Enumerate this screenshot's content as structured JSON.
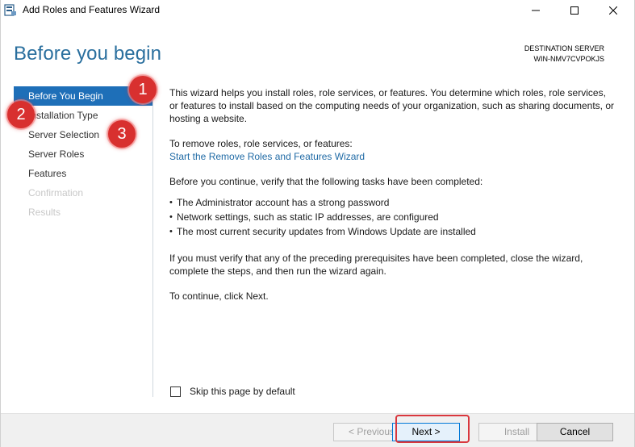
{
  "window": {
    "title": "Add Roles and Features Wizard"
  },
  "header": {
    "page_title": "Before you begin",
    "destination_label": "DESTINATION SERVER",
    "destination_server": "WIN-NMV7CVPOKJS"
  },
  "nav": {
    "items": [
      {
        "label": "Before You Begin",
        "state": "active"
      },
      {
        "label": "Installation Type",
        "state": "normal"
      },
      {
        "label": "Server Selection",
        "state": "normal"
      },
      {
        "label": "Server Roles",
        "state": "normal"
      },
      {
        "label": "Features",
        "state": "normal"
      },
      {
        "label": "Confirmation",
        "state": "disabled"
      },
      {
        "label": "Results",
        "state": "disabled"
      }
    ]
  },
  "content": {
    "intro": "This wizard helps you install roles, role services, or features. You determine which roles, role services, or features to install based on the computing needs of your organization, such as sharing documents, or hosting a website.",
    "remove_text": "To remove roles, role services, or features:",
    "remove_link": "Start the Remove Roles and Features Wizard",
    "verify_text": "Before you continue, verify that the following tasks have been completed:",
    "bullets": [
      "The Administrator account has a strong password",
      "Network settings, such as static IP addresses, are configured",
      "The most current security updates from Windows Update are installed"
    ],
    "prereq_text": "If you must verify that any of the preceding prerequisites have been completed, close the wizard, complete the steps, and then run the wizard again.",
    "continue_text": "To continue, click Next."
  },
  "skip": {
    "label": "Skip this page by default",
    "checked": false
  },
  "footer": {
    "previous_label": "< Previous",
    "next_label": "Next >",
    "install_label": "Install",
    "cancel_label": "Cancel"
  },
  "markers": [
    "1",
    "2",
    "3"
  ],
  "colors": {
    "title_blue": "#2a6f9e",
    "nav_active": "#1e6fb8",
    "link": "#1f6aa5",
    "marker_red": "#d8302f"
  }
}
